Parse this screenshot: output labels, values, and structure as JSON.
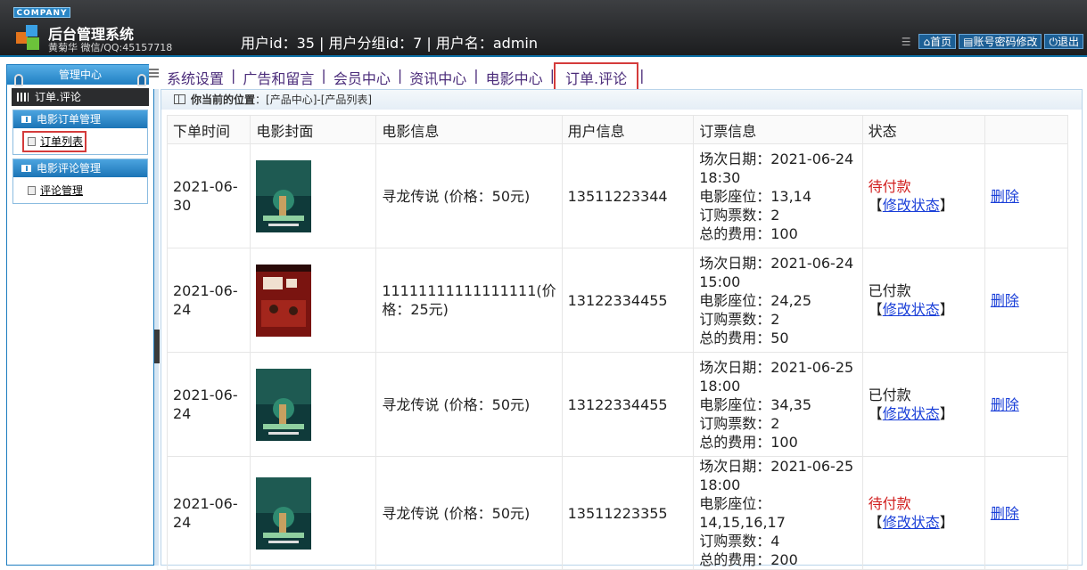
{
  "header": {
    "company": "COMPANY",
    "title": "后台管理系统",
    "author": "黄菊华 微信/QQ:45157718",
    "userinfo": "用户id：35 | 用户分组id：7 | 用户名：admin",
    "links": {
      "home": "首页",
      "account": "账号密码修改",
      "logout": "退出"
    }
  },
  "sidebar": {
    "panel_title": "管理中心",
    "current": "订单.评论",
    "groups": [
      {
        "title": "电影订单管理",
        "link": "订单列表"
      },
      {
        "title": "电影评论管理",
        "link": "评论管理"
      }
    ]
  },
  "nav": {
    "items": [
      "系统设置",
      "广告和留言",
      "会员中心",
      "资讯中心",
      "电影中心",
      "订单.评论"
    ],
    "separator": "|"
  },
  "breadcrumb": {
    "label": "你当前的位置",
    "path": "：[产品中心]-[产品列表]"
  },
  "table": {
    "headers": [
      "下单时间",
      "电影封面",
      "电影信息",
      "用户信息",
      "订票信息",
      "状态",
      ""
    ],
    "action_delete": "删除",
    "action_modify": "修改状态",
    "rows": [
      {
        "time": "2021-06-30",
        "movie": "寻龙传说 (价格：50元)",
        "user": "13511223344",
        "ticket": [
          "场次日期：2021-06-24 18:30",
          "电影座位：13,14",
          "订购票数：2",
          "总的费用：100"
        ],
        "status": "待付款"
      },
      {
        "time": "2021-06-24",
        "movie": "11111111111111111(价格：25元)",
        "user": "13122334455",
        "ticket": [
          "场次日期：2021-06-24 15:00",
          "电影座位：24,25",
          "订购票数：2",
          "总的费用：50"
        ],
        "status": "已付款"
      },
      {
        "time": "2021-06-24",
        "movie": "寻龙传说 (价格：50元)",
        "user": "13122334455",
        "ticket": [
          "场次日期：2021-06-25 18:00",
          "电影座位：34,35",
          "订购票数：2",
          "总的费用：100"
        ],
        "status": "已付款"
      },
      {
        "time": "2021-06-24",
        "movie": "寻龙传说 (价格：50元)",
        "user": "13511223355",
        "ticket": [
          "场次日期：2021-06-25 18:00",
          "电影座位：14,15,16,17",
          "订购票数：4",
          "总的费用：200"
        ],
        "status": "待付款"
      }
    ]
  },
  "colors": {
    "pending": "#d11f1f",
    "link": "#1a3fd8",
    "nav_text": "#4b2c7a",
    "highlight": "#d43b3b"
  }
}
